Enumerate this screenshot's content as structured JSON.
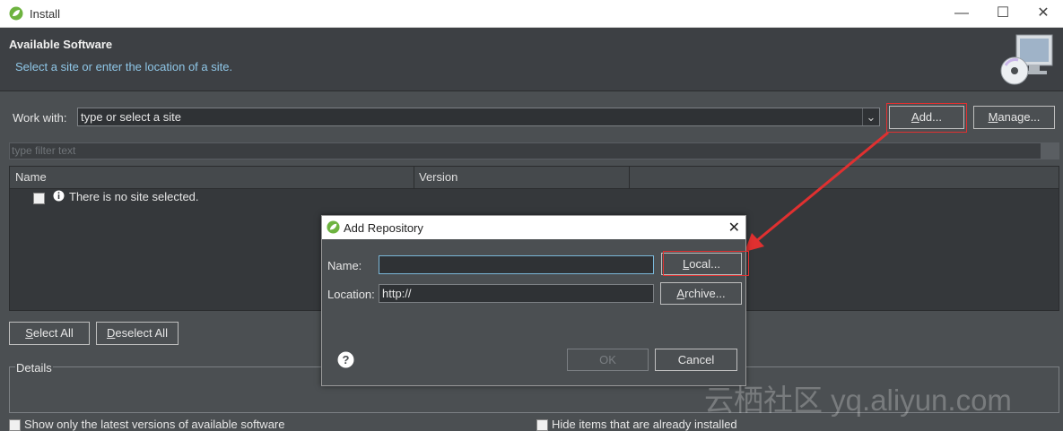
{
  "window": {
    "title": "Install",
    "minimize": "—",
    "maximize": "☐",
    "close": "✕"
  },
  "header": {
    "title": "Available Software",
    "subtitle": "Select a site or enter the location of a site."
  },
  "work_with": {
    "label": "Work with:",
    "value": "type or select a site",
    "dropdown_arrow": "⌄",
    "add_button": {
      "pre": "",
      "u": "A",
      "post": "dd..."
    },
    "manage_button": {
      "pre": "",
      "u": "M",
      "post": "anage..."
    }
  },
  "filter": {
    "placeholder": "type filter text"
  },
  "table": {
    "columns": [
      "Name",
      "Version"
    ],
    "rows": [
      {
        "text": "There is no site selected."
      }
    ]
  },
  "buttons": {
    "select_all": {
      "pre": "",
      "u": "S",
      "post": "elect All"
    },
    "deselect_all": {
      "pre": "",
      "u": "D",
      "post": "eselect All"
    }
  },
  "details": {
    "label": "Details"
  },
  "bottom": {
    "left": "Show only the latest versions of available software",
    "right": "Hide items that are already installed"
  },
  "dialog": {
    "title": "Add Repository",
    "close": "✕",
    "name_label": "Name:",
    "name_value": "",
    "location_label": "Location:",
    "location_value": "http://",
    "local_button": {
      "pre": "",
      "u": "L",
      "post": "ocal..."
    },
    "archive_button": {
      "pre": "",
      "u": "A",
      "post": "rchive..."
    },
    "ok_button": "OK",
    "cancel_button": "Cancel",
    "help": "?"
  },
  "watermark": "云栖社区 yq.aliyun.com",
  "colors": {
    "highlight": "#e03030",
    "accent_text": "#8fc7e8",
    "app_icon": "#6db33f"
  }
}
